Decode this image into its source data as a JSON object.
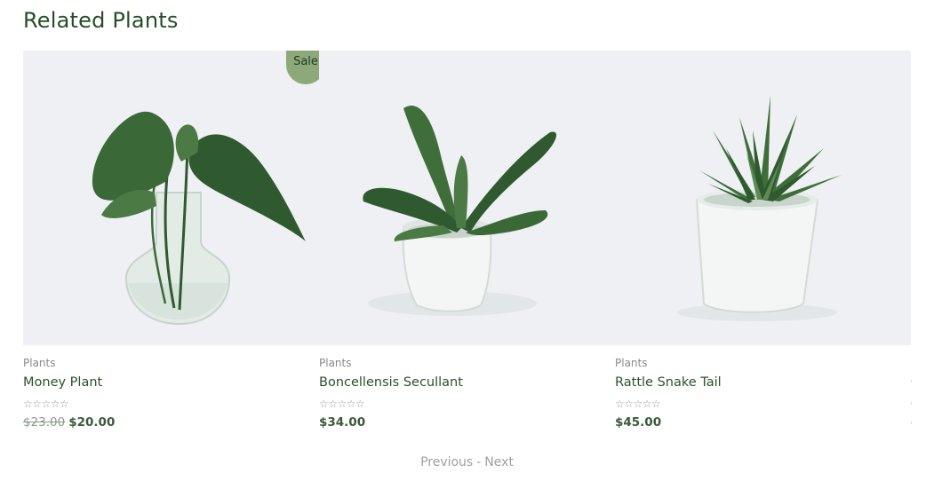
{
  "section": {
    "title": "Related Plants"
  },
  "badge": {
    "sale_label": "Sale"
  },
  "products": [
    {
      "category": "Plants",
      "name": "Money Plant",
      "rating": "☆☆☆☆☆",
      "old_price": "$23.00",
      "price": "$20.00",
      "image_icon": "money-plant-in-glass-vase"
    },
    {
      "category": "Plants",
      "name": "Boncellensis Secullant",
      "rating": "☆☆☆☆☆",
      "old_price": null,
      "price": "$34.00",
      "image_icon": "succulent-in-white-pot"
    },
    {
      "category": "Plants",
      "name": "Rattle Snake Tail",
      "rating": "☆☆☆☆☆",
      "old_price": null,
      "price": "$45.00",
      "image_icon": "aloe-in-white-pot"
    }
  ],
  "pagination": {
    "previous_label": "Previous",
    "separator": "-",
    "next_label": "Next"
  },
  "colors": {
    "heading": "#274d27",
    "leaf_dark": "#2f5a2f",
    "leaf_mid": "#4b7a45",
    "image_bg": "#eef0f3",
    "sale_badge": "#8da87a"
  }
}
